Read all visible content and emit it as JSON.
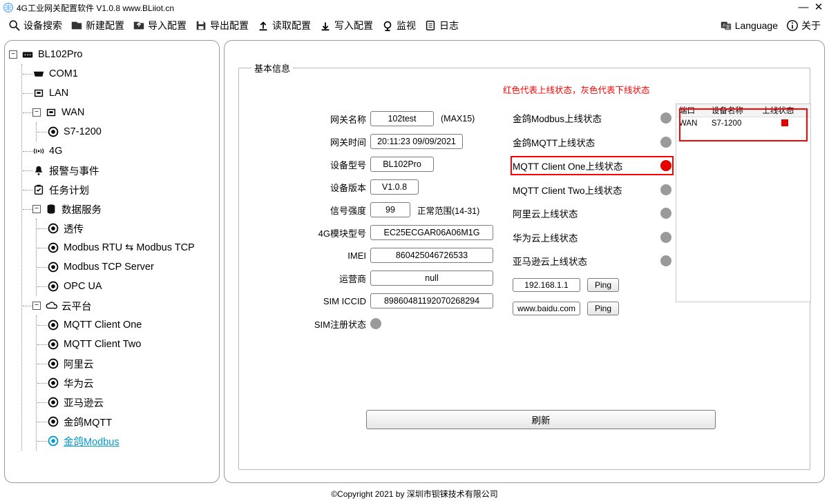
{
  "app": {
    "title": "4G工业网关配置软件 V1.0.8 www.BLiiot.cn"
  },
  "toolbar": {
    "search": "设备搜索",
    "newcfg": "新建配置",
    "import": "导入配置",
    "export": "导出配置",
    "read": "读取配置",
    "write": "写入配置",
    "monitor": "监视",
    "log": "日志",
    "language": "Language",
    "about": "关于"
  },
  "tree": {
    "root": "BL102Pro",
    "com1": "COM1",
    "lan": "LAN",
    "wan": "WAN",
    "wan_s7": "S7-1200",
    "g4": "4G",
    "alarm": "报警与事件",
    "task": "任务计划",
    "svc": "数据服务",
    "svc_trans": "透传",
    "svc_mb": "Modbus RTU ⇆ Modbus TCP",
    "svc_mbtcp": "Modbus TCP Server",
    "svc_opc": "OPC UA",
    "cloud": "云平台",
    "cl1": "MQTT Client One",
    "cl2": "MQTT Client Two",
    "cl_ali": "阿里云",
    "cl_hw": "华为云",
    "cl_aws": "亚马逊云",
    "cl_jgmqtt": "金鸽MQTT",
    "cl_jgmb": "金鸽Modbus"
  },
  "panel": {
    "legend": "基本信息",
    "note": "红色代表上线状态，灰色代表下线状态",
    "labels": {
      "gw_name": "网关名称",
      "gw_name_tail": "(MAX15)",
      "gw_time": "网关时间",
      "model": "设备型号",
      "ver": "设备版本",
      "signal": "信号强度",
      "signal_tail": "正常范围(14-31)",
      "module": "4G模块型号",
      "imei": "IMEI",
      "carrier": "运营商",
      "iccid": "SIM ICCID",
      "simreg": "SIM注册状态"
    },
    "values": {
      "gw_name": "102test",
      "gw_time": "20:11:23 09/09/2021",
      "model": "BL102Pro",
      "ver": "V1.0.8",
      "signal": "99",
      "module": "EC25ECGAR06A06M1G",
      "imei": "860425046726533",
      "carrier": "null",
      "iccid": "89860481192070268294"
    },
    "statuses": [
      {
        "label": "金鸽Modbus上线状态",
        "online": false
      },
      {
        "label": "金鸽MQTT上线状态",
        "online": false
      },
      {
        "label": "MQTT Client One上线状态",
        "online": true,
        "highlight": true
      },
      {
        "label": "MQTT Client Two上线状态",
        "online": false
      },
      {
        "label": "阿里云上线状态",
        "online": false
      },
      {
        "label": "华为云上线状态",
        "online": false
      },
      {
        "label": "亚马逊云上线状态",
        "online": false
      }
    ],
    "ping": [
      {
        "addr": "192.168.1.1",
        "btn": "Ping"
      },
      {
        "addr": "www.baidu.com",
        "btn": "Ping"
      }
    ],
    "refresh": "刷新",
    "table": {
      "cols": [
        "端口",
        "设备名称",
        "上线状态"
      ],
      "rows": [
        {
          "port": "WAN",
          "name": "S7-1200",
          "online": true
        }
      ]
    }
  },
  "footer": "©Copyright 2021 by 深圳市钡铼技术有限公司"
}
